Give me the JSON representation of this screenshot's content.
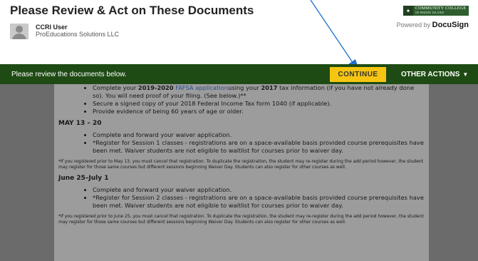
{
  "header": {
    "title": "Please Review & Act on These Documents",
    "user_name": "CCRI User",
    "user_org": "ProEducations Solutions LLC",
    "logo_line1": "COMMUNITY COLLEGE",
    "logo_line2": "OF RHODE ISLAND",
    "powered_prefix": "Powered by",
    "powered_brand": "DocuSign"
  },
  "actionbar": {
    "message": "Please review the documents below.",
    "continue_label": "CONTINUE",
    "other_actions_label": "OTHER ACTIONS",
    "bar_color": "#1e4b14",
    "button_color": "#f6c512"
  },
  "document": {
    "bullets_top": {
      "b1_pre": "Complete your",
      "b1_year": "2019-2020",
      "b1_link": "FAFSA application",
      "b1_mid": "using your",
      "b1_year2": "2017",
      "b1_post": "tax information (if you have not already done so). You will need proof of your filing. (See below.)**",
      "b2": "Secure a signed copy of your 2018 Federal Income Tax form 1040 (if applicable).",
      "b3": "Provide evidence of being 60 years of age or older."
    },
    "section1": {
      "heading": "MAY 13 – 20",
      "b1": "Complete and forward your waiver application.",
      "b2": "*Register for Session 1 classes - registrations are on a space-available basis provided course prerequisites have been met. Waiver students are not eligible to waitlist for courses prior to waiver day.",
      "note": "*If you registered prior to May 13, you must cancel that registration. To duplicate the registration, the student may re-register during the add period however, the student may register for those same courses but different sessions beginning Waiver Day. Students can also register for other courses as well."
    },
    "section2": {
      "heading": "June 25–July 1",
      "b1": "Complete and forward your waiver application.",
      "b2": "*Register for Session 2 classes - registrations are on a space-available basis provided course prerequisites have been met. Waiver students are not eligible to waitlist for courses prior to waiver day.",
      "note": "*If you registered prior to June 25, you must cancel that registration. To duplicate the registration, the student may re-register during the add period however, the student may register for those same courses but different sessions beginning Waiver Day. Students can also register for other courses as well."
    }
  }
}
